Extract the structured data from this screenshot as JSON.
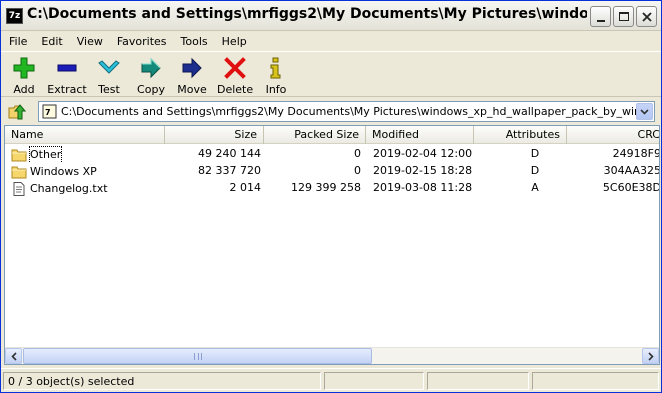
{
  "window": {
    "app_icon": "7z",
    "title": "C:\\Documents and Settings\\mrfiggs2\\My Documents\\My Pictures\\windows_xp_hd_wallp..."
  },
  "menu": [
    "File",
    "Edit",
    "View",
    "Favorites",
    "Tools",
    "Help"
  ],
  "toolbar": {
    "add": "Add",
    "extract": "Extract",
    "test": "Test",
    "copy": "Copy",
    "move": "Move",
    "delete": "Delete",
    "info": "Info"
  },
  "address": {
    "path": "C:\\Documents and Settings\\mrfiggs2\\My Documents\\My Pictures\\windows_xp_hd_wallpaper_pack_by_windowssenpai-d"
  },
  "columns": {
    "name": "Name",
    "size": "Size",
    "packed": "Packed Size",
    "modified": "Modified",
    "attributes": "Attributes",
    "crc": "CRC"
  },
  "files": [
    {
      "name": "Other",
      "size": "49 240 144",
      "packed": "0",
      "modified": "2019-02-04 12:00",
      "attributes": "D",
      "crc": "24918F9",
      "icon": "folder-icon"
    },
    {
      "name": "Windows XP",
      "size": "82 337 720",
      "packed": "0",
      "modified": "2019-02-15 18:28",
      "attributes": "D",
      "crc": "304AA325",
      "icon": "folder-icon"
    },
    {
      "name": "Changelog.txt",
      "size": "2 014",
      "packed": "129 399 258",
      "modified": "2019-03-08 11:28",
      "attributes": "A",
      "crc": "5C60E38D",
      "icon": "text-file-icon"
    }
  ],
  "status": {
    "selection": "0 / 3 object(s) selected"
  },
  "colors": {
    "title_border": "#0831d9",
    "add_icon": "#22b622",
    "extract_icon": "#1c1cb8",
    "test_icon": "#2bbfd9",
    "copy_icon": "#168a7a",
    "move_icon": "#1d2e8f",
    "delete_icon": "#e01010",
    "info_icon": "#d8c51b"
  }
}
